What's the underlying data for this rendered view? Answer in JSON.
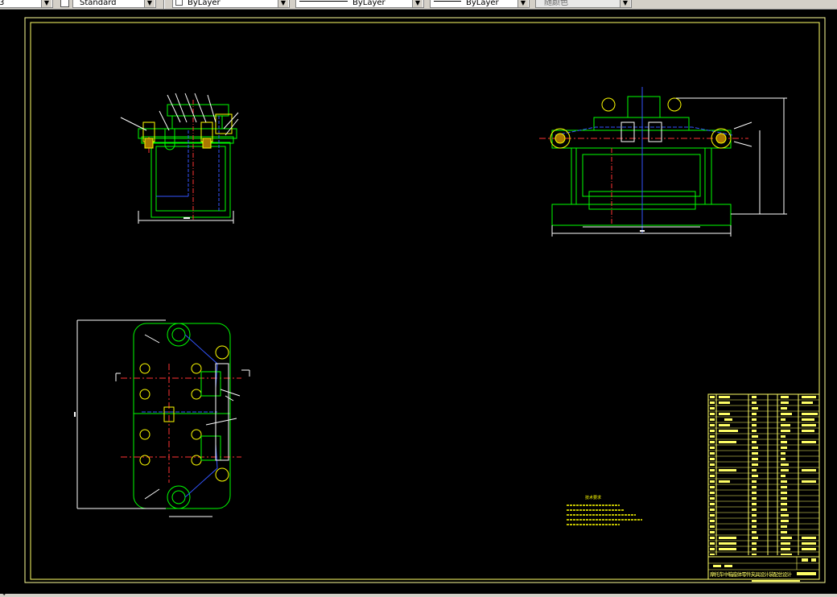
{
  "toolbar": {
    "textstyle_value": "Standard",
    "layer_value": "ByLayer",
    "linetype_value": "ByLayer",
    "lineweight_value": "ByLayer",
    "plotstyle_value": "随颜色"
  },
  "drawing": {
    "notes_title": "技术要求",
    "title_block_caption": "摩托车中箱座体零件夹具设计装配总设计"
  },
  "statusbar": {
    "text": "Ψ"
  },
  "colors": {
    "background": "#000000",
    "border": "#ffff66",
    "outline": "#00ff00",
    "hidden": "#3355ff",
    "centerline": "#ff3333",
    "dimension": "#ffffff",
    "accent": "#ffff00"
  }
}
